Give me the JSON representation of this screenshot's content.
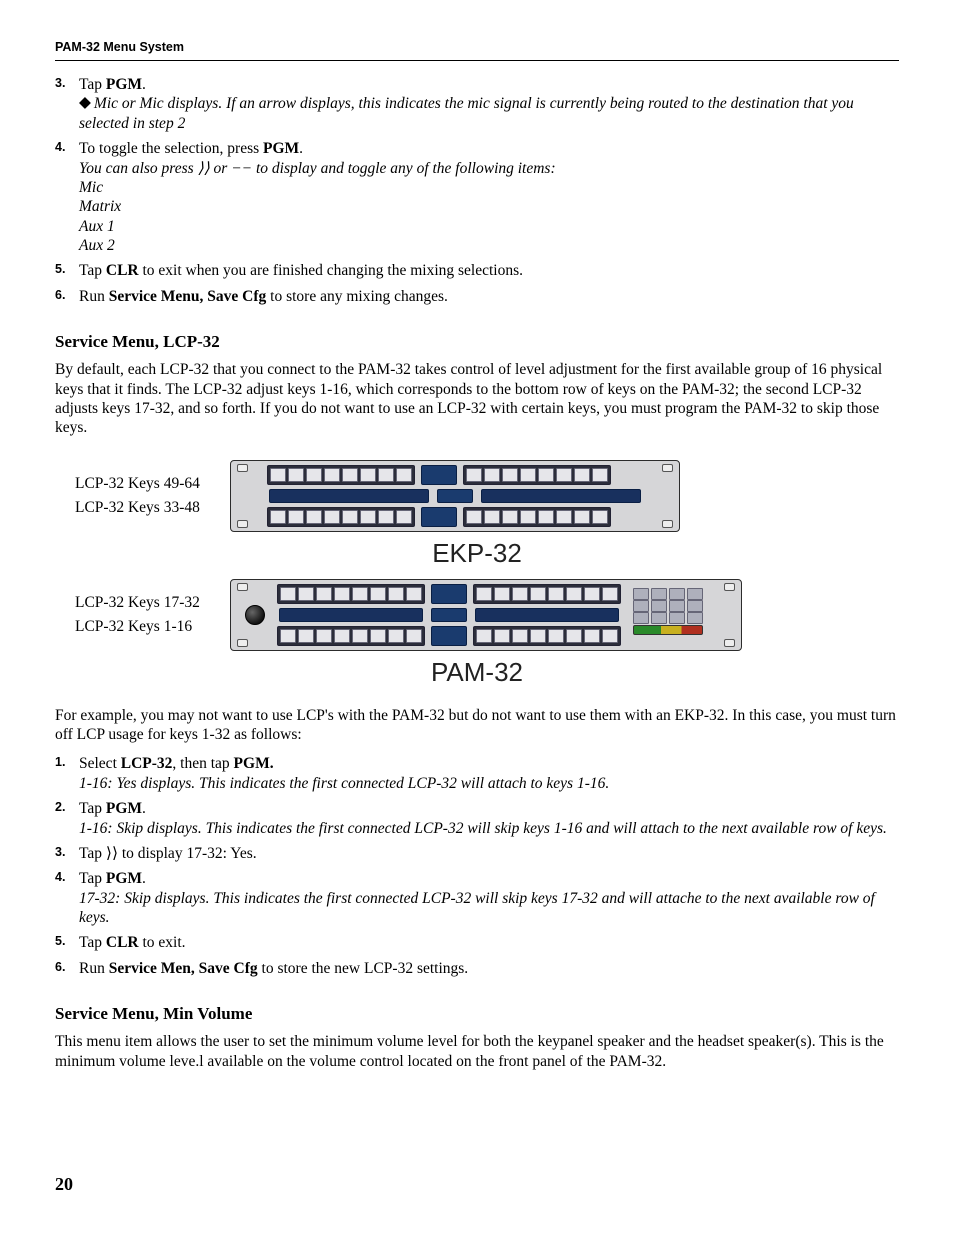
{
  "header": {
    "running": "PAM-32 Menu System"
  },
  "stepsA": [
    {
      "n": "3.",
      "lead": "Tap ",
      "bold": "PGM",
      "tail": ".",
      "note_prefix": "◆",
      "note": "Mic or Mic displays. If an arrow displays, this indicates the mic signal is currently being routed to the destination that you selected in step 2"
    },
    {
      "n": "4.",
      "lead": "To toggle the selection, press ",
      "bold": "PGM",
      "tail": ".",
      "note": "You can also press ⟩⟩ or −− to display and toggle any of the following items:",
      "items": [
        "Mic",
        "Matrix",
        "Aux 1",
        "Aux 2"
      ]
    },
    {
      "n": "5.",
      "lead": "Tap ",
      "bold": "CLR",
      "tail": " to exit when you are finished changing the mixing selections."
    },
    {
      "n": "6.",
      "lead": "Run ",
      "bold": "Service Menu, Save Cfg",
      "tail": " to store any mixing changes."
    }
  ],
  "section1": {
    "title": "Service Menu, LCP-32",
    "para": "By default, each LCP-32 that you connect to the PAM-32 takes control of level adjustment for the first available group of 16 physical keys that it finds. The LCP-32 adjust keys 1-16, which corresponds to the bottom row of keys on the PAM-32; the second LCP-32 adjusts keys 17-32, and so forth. If you do not want to use an LCP-32 with certain keys, you must program the PAM-32 to skip those keys."
  },
  "figure": {
    "ekp_labels": [
      "LCP-32 Keys 49-64",
      "LCP-32 Keys 33-48"
    ],
    "ekp_caption": "EKP-32",
    "pam_labels": [
      "LCP-32 Keys 17-32",
      "LCP-32 Keys 1-16"
    ],
    "pam_caption": "PAM-32"
  },
  "para2": "For example, you may not want to use LCP's with the PAM-32 but do not want to use them with an EKP-32. In this case, you must turn off LCP usage for keys 1-32 as follows:",
  "stepsB": [
    {
      "n": "1.",
      "lead": "Select ",
      "bold": "LCP-32",
      "mid": ", then tap ",
      "bold2": "PGM.",
      "note": "1-16: Yes displays. This indicates the first connected LCP-32 will attach to keys 1-16."
    },
    {
      "n": "2.",
      "lead": "Tap ",
      "bold": "PGM",
      "tail": ".",
      "note": "1-16: Skip displays. This indicates the first connected LCP-32 will skip keys 1-16 and will attach to the next available row of keys."
    },
    {
      "n": "3.",
      "lead": "Tap ",
      "plain_mid": "⟩⟩ to display 17-32: Yes."
    },
    {
      "n": "4.",
      "lead": "Tap ",
      "bold": "PGM",
      "tail": ".",
      "note": "17-32: Skip displays. This indicates the first connected LCP-32 will skip keys 17-32 and will attache to the next available row of keys."
    },
    {
      "n": "5.",
      "lead": "Tap ",
      "bold": "CLR",
      "tail": " to exit."
    },
    {
      "n": "6.",
      "lead": "Run ",
      "bold": "Service Men, Save Cfg",
      "tail": " to store the new LCP-32 settings."
    }
  ],
  "section2": {
    "title": "Service Menu, Min Volume",
    "para": "This menu item allows the user to set the minimum volume level for both the keypanel speaker and the headset speaker(s). This is the minimum volume leve.l available on the volume control located on the front panel of the PAM-32."
  },
  "page_number": "20"
}
